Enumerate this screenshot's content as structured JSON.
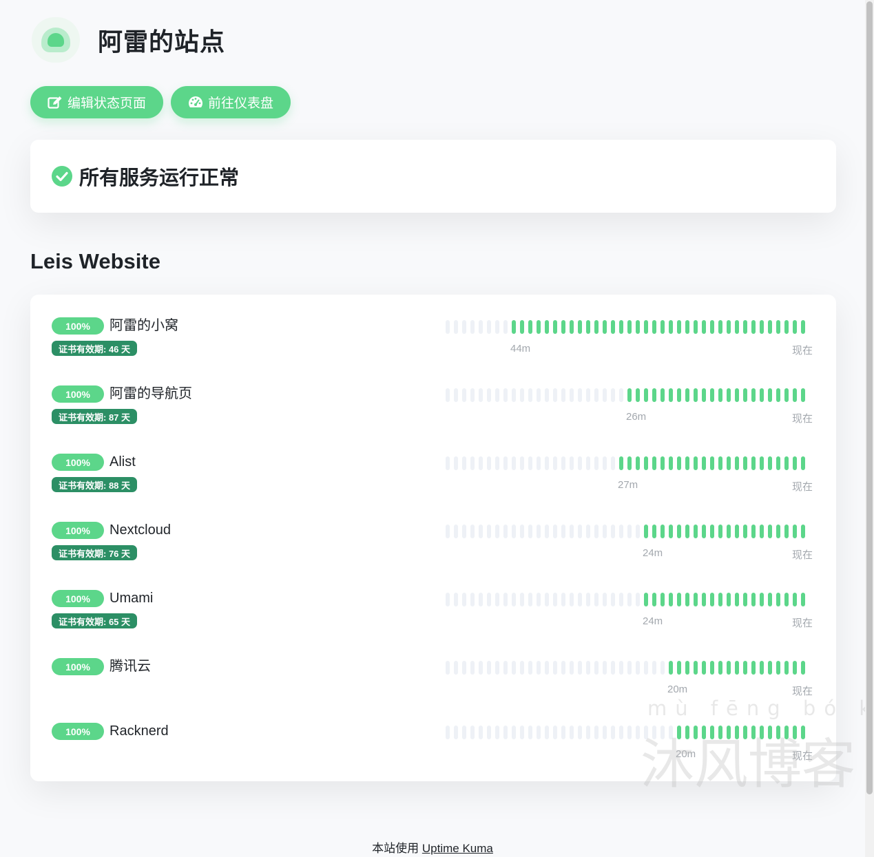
{
  "header": {
    "title": "阿雷的站点",
    "logo_icon": "kuma-logo-icon"
  },
  "actions": {
    "edit_label": "编辑状态页面",
    "edit_icon": "edit-icon",
    "dashboard_label": "前往仪表盘",
    "dashboard_icon": "dashboard-gauge-icon"
  },
  "overall_status": {
    "text": "所有服务运行正常",
    "icon": "check-circle-icon"
  },
  "group": {
    "title": "Leis Website",
    "now_label": "现在",
    "monitors": [
      {
        "name": "阿雷的小窝",
        "uptime": "100%",
        "cert": "证书有效期: 46 天",
        "start_label": "44m",
        "up_beats": 36
      },
      {
        "name": "阿雷的导航页",
        "uptime": "100%",
        "cert": "证书有效期: 87 天",
        "start_label": "26m",
        "up_beats": 22
      },
      {
        "name": "Alist",
        "uptime": "100%",
        "cert": "证书有效期: 88 天",
        "start_label": "27m",
        "up_beats": 23
      },
      {
        "name": "Nextcloud",
        "uptime": "100%",
        "cert": "证书有效期: 76 天",
        "start_label": "24m",
        "up_beats": 20
      },
      {
        "name": "Umami",
        "uptime": "100%",
        "cert": "证书有效期: 65 天",
        "start_label": "24m",
        "up_beats": 20
      },
      {
        "name": "腾讯云",
        "uptime": "100%",
        "cert": "",
        "start_label": "20m",
        "up_beats": 17
      },
      {
        "name": "Racknerd",
        "uptime": "100%",
        "cert": "",
        "start_label": "20m",
        "up_beats": 16
      }
    ]
  },
  "footer": {
    "prefix": "本站使用",
    "link": "Uptime Kuma"
  },
  "watermark": {
    "pinyin": "mù fēng bó kè",
    "chars": "沐风博客"
  },
  "colors": {
    "accent": "#5cd68a",
    "cert_badge": "#2c8f65",
    "empty_beat": "#eef1f6"
  }
}
